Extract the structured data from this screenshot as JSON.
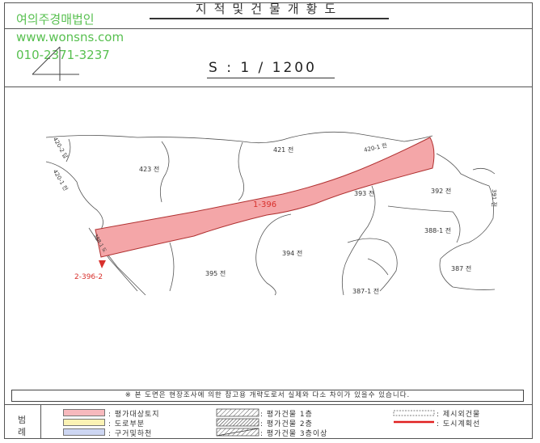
{
  "header": {
    "title": "지적및건물개황도",
    "scale": "S : 1 / 1200"
  },
  "watermark": {
    "company": "여의주경매법인",
    "url": "www.wonsns.com",
    "phone": "010-2371-3237"
  },
  "map": {
    "subject_lot": "1-396",
    "subject_lot_2": "2-396-2",
    "lots": [
      "421 전",
      "423 전",
      "420-1 전",
      "420-2 답",
      "420-1 전",
      "393 전",
      "392 전",
      "388-1 전",
      "394 전",
      "387 전",
      "395 전",
      "387-1 전",
      "391 전",
      "388-1 도"
    ],
    "colors": {
      "subject_fill": "#f4a6a8",
      "subject_stroke": "#b03030",
      "label_red": "#d8302c",
      "watermark_green": "#58c050"
    }
  },
  "notice": "※ 본 도면은 현장조사에 의한 참고용 개략도로서 실제와 다소 차이가 있을수 있습니다.",
  "legend": {
    "label": "범례",
    "items": [
      {
        "text": ": 평가대상토지",
        "color": "#f7b9bd"
      },
      {
        "text": ": 도로부분",
        "color": "#fbf2b4"
      },
      {
        "text": ": 구거및하천",
        "color": "#cdd6f2"
      },
      {
        "text": ": 평가건물 1층"
      },
      {
        "text": ": 평가건물 2층"
      },
      {
        "text": ": 평가건물 3층이상"
      },
      {
        "text": ": 제시외건물"
      },
      {
        "text": ": 도시계획선",
        "color": "#e02020"
      }
    ]
  }
}
